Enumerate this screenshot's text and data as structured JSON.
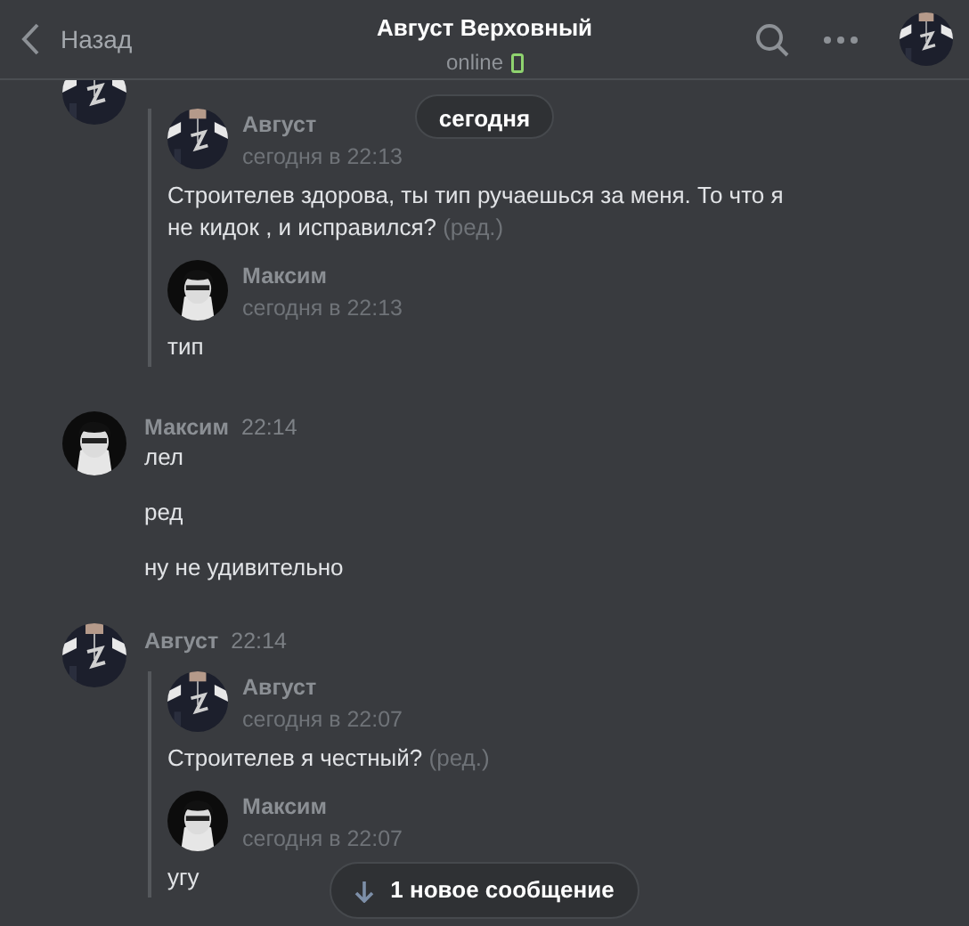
{
  "header": {
    "back": "Назад",
    "title": "Август Верховный",
    "status": "online",
    "mobile": true
  },
  "date_pill": "сегодня",
  "messages": [
    {
      "forwarded": [
        {
          "author": "Август",
          "date": "сегодня в 22:13",
          "text": "Строителев здорова, ты тип ручаешься за меня. То что я не кидок , и исправился?",
          "edited": "(ред.)"
        },
        {
          "author": "Максим",
          "date": "сегодня в 22:13",
          "text": "тип"
        }
      ]
    },
    {
      "author": "Максим",
      "time": "22:14",
      "lines": [
        "лел",
        "ред",
        "ну не удивительно"
      ]
    },
    {
      "author": "Август",
      "time": "22:14",
      "forwarded": [
        {
          "author": "Август",
          "date": "сегодня в 22:07",
          "text": "Строителев я честный?",
          "edited": "(ред.)"
        },
        {
          "author": "Максим",
          "date": "сегодня в 22:07",
          "text": "угу"
        }
      ]
    }
  ],
  "new_messages": "1 новое сообщение"
}
